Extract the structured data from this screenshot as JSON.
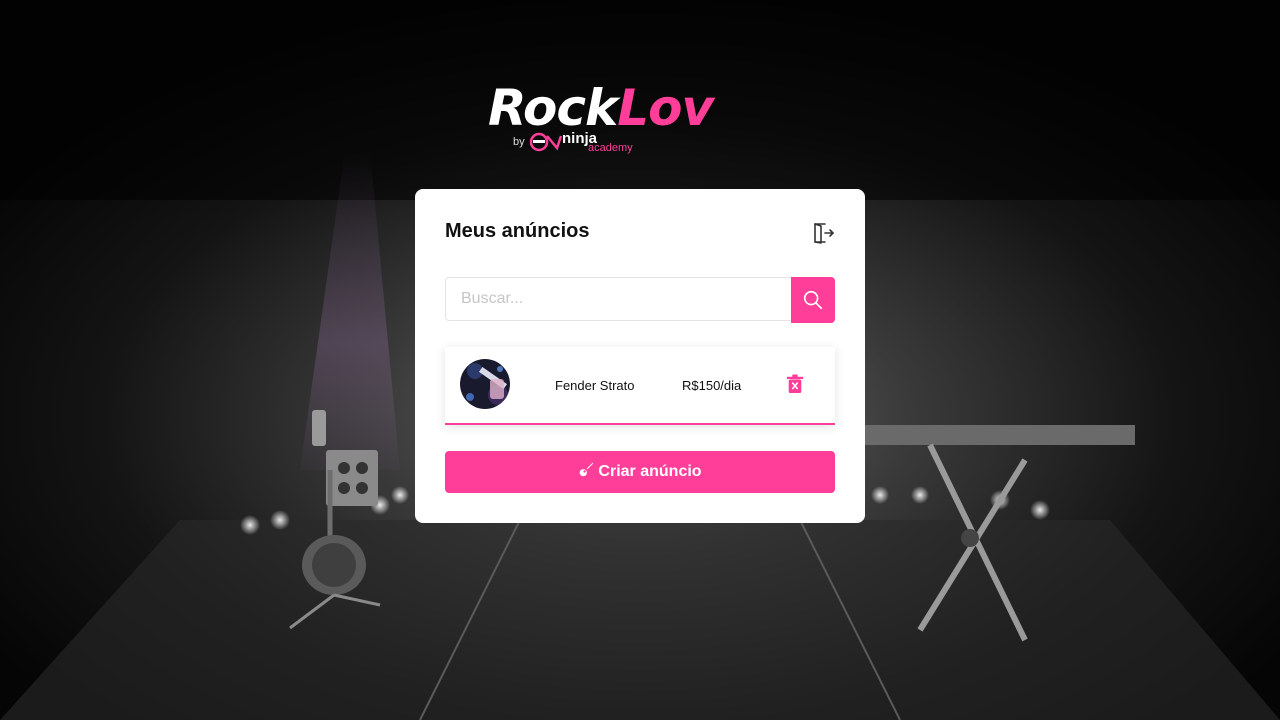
{
  "brand": {
    "name_part1": "Rock",
    "name_part2": "Lov",
    "by_label": "by",
    "partner_name": "ninja",
    "partner_suffix": "academy",
    "accent_color": "#ff3e9a"
  },
  "panel": {
    "title": "Meus anúncios",
    "logout_icon": "logout-icon"
  },
  "search": {
    "placeholder": "Buscar...",
    "value": "",
    "icon": "search-icon"
  },
  "listings": [
    {
      "name": "Fender Strato",
      "price": "R$150/dia",
      "thumbnail_icon": "guitar-photo",
      "delete_icon": "trash-icon"
    }
  ],
  "actions": {
    "create_label": "Criar anúncio",
    "create_icon": "guitar-icon"
  }
}
